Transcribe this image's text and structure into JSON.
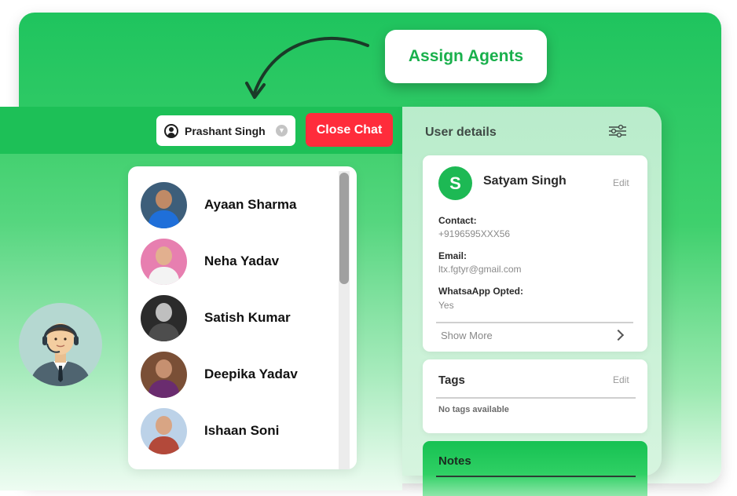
{
  "banner": {
    "assign_label": "Assign Agents"
  },
  "chat_header": {
    "agent_name": "Prashant Singh",
    "close_label": "Close Chat"
  },
  "contacts": [
    {
      "name": "Ayaan Sharma",
      "bg": "#3d5e7a",
      "shirt": "#1f6fd9",
      "skin": "#c08a66"
    },
    {
      "name": "Neha Yadav",
      "bg": "#e77fb0",
      "shirt": "#f3f3f3",
      "skin": "#e2b08f"
    },
    {
      "name": "Satish Kumar",
      "bg": "#2b2b2b",
      "shirt": "#4d4d4d",
      "skin": "#bfbfbf"
    },
    {
      "name": "Deepika Yadav",
      "bg": "#7a4f36",
      "shirt": "#6a2c6f",
      "skin": "#c69070"
    },
    {
      "name": "Ishaan Soni",
      "bg": "#bcd2e8",
      "shirt": "#b3493a",
      "skin": "#d8a584"
    }
  ],
  "details": {
    "title": "User details",
    "user": {
      "initial": "S",
      "name": "Satyam Singh",
      "edit_label": "Edit",
      "contact_label": "Contact:",
      "contact_value": "+9196595XXX56",
      "email_label": "Email:",
      "email_value": "ltx.fgtyr@gmail.com",
      "whatsapp_label": "WhatsaApp Opted:",
      "whatsapp_value": "Yes",
      "show_more_label": "Show More"
    },
    "tags": {
      "title": "Tags",
      "edit_label": "Edit",
      "empty_text": "No tags available"
    },
    "notes": {
      "title": "Notes"
    }
  },
  "colors": {
    "brand_green": "#1dc057",
    "close_red": "#ff2c3b",
    "avatar_green": "#1db954"
  }
}
